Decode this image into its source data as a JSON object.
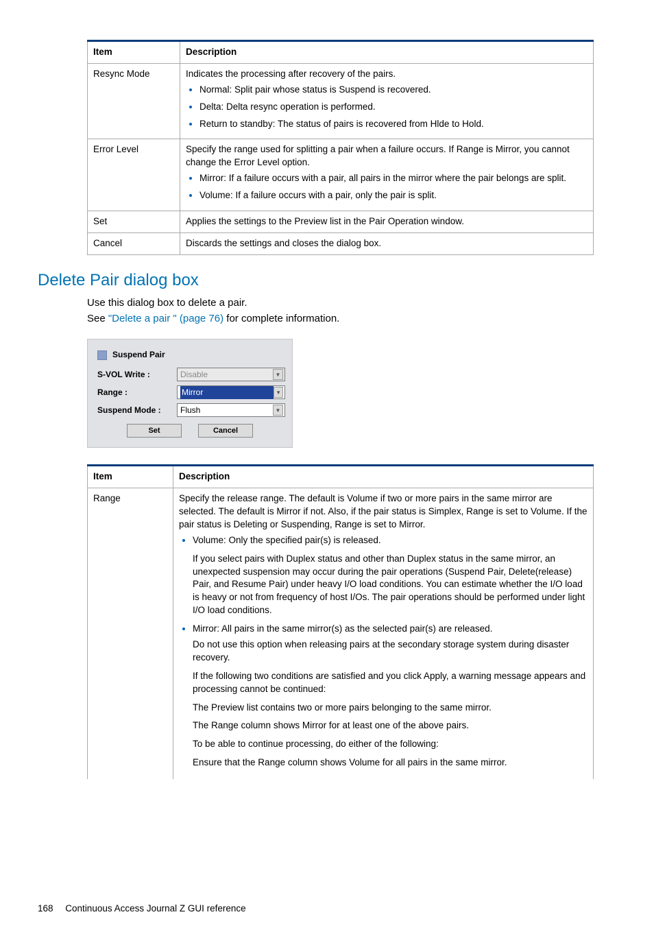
{
  "table1": {
    "headers": [
      "Item",
      "Description"
    ],
    "rows": [
      {
        "item": "Resync Mode",
        "intro": "Indicates the processing after recovery of the pairs.",
        "bullets": [
          "Normal: Split pair whose status is Suspend is recovered.",
          "Delta: Delta resync operation is performed.",
          "Return to standby: The status of pairs is recovered from Hlde to Hold."
        ]
      },
      {
        "item": "Error Level",
        "intro": "Specify the range used for splitting a pair when a failure occurs. If Range is Mirror, you cannot change the Error Level option.",
        "bullets": [
          "Mirror: If a failure occurs with a pair, all pairs in the mirror where the pair belongs are split.",
          "Volume: If a failure occurs with a pair, only the pair is split."
        ]
      },
      {
        "item": "Set",
        "intro": "Applies the settings to the Preview list in the Pair Operation window."
      },
      {
        "item": "Cancel",
        "intro": "Discards the settings and closes the dialog box."
      }
    ]
  },
  "section": {
    "title": "Delete Pair dialog box",
    "body1": "Use this dialog box to delete a pair.",
    "body2_pre": "See ",
    "body2_link": "\"Delete a pair \" (page 76)",
    "body2_post": " for complete information."
  },
  "dialog": {
    "title": "Suspend Pair",
    "rows": [
      {
        "label": "S-VOL Write :",
        "value": "Disable",
        "state": "disabled"
      },
      {
        "label": "Range :",
        "value": "Mirror",
        "state": "selected"
      },
      {
        "label": "Suspend Mode :",
        "value": "Flush",
        "state": "normal"
      }
    ],
    "buttons": {
      "set": "Set",
      "cancel": "Cancel"
    }
  },
  "table2": {
    "headers": [
      "Item",
      "Description"
    ],
    "row": {
      "item": "Range",
      "intro": "Specify the release range. The default is Volume if two or more pairs in the same mirror are selected. The default is Mirror if not. Also, if the pair status is Simplex, Range is set to Volume. If the pair status is Deleting or Suspending, Range is set to Mirror.",
      "b1": "Volume: Only the specified pair(s) is released.",
      "b1_sub": "If you select pairs with Duplex status and other than Duplex status in the same mirror, an unexpected suspension may occur during the pair operations (Suspend Pair, Delete(release) Pair, and Resume Pair) under heavy I/O load conditions. You can estimate whether the I/O load is heavy or not from frequency of host I/Os. The pair operations should be performed under light I/O load conditions.",
      "b2": "Mirror: All pairs in the same mirror(s) as the selected pair(s) are released.",
      "b2_p1": "Do not use this option when releasing pairs at the secondary storage system during disaster recovery.",
      "b2_p2": "If the following two conditions are satisfied and you click Apply, a warning message appears and processing cannot be continued:",
      "b2_p3": "The Preview list contains two or more pairs belonging to the same mirror.",
      "b2_p4": "The Range column shows Mirror for at least one of the above pairs.",
      "b2_p5": "To be able to continue processing, do either of the following:",
      "b2_p6": "Ensure that the Range column shows Volume for all pairs in the same mirror."
    }
  },
  "footer": {
    "page": "168",
    "title": "Continuous Access Journal Z GUI reference"
  }
}
